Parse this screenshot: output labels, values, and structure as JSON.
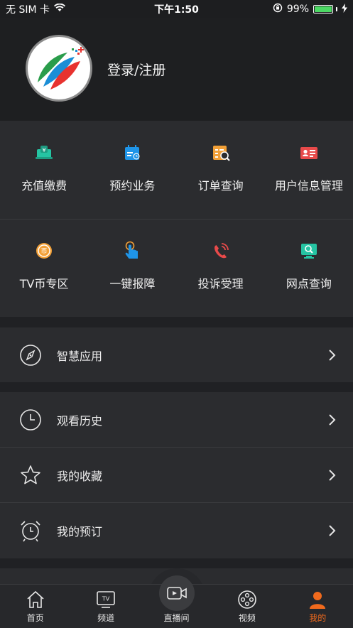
{
  "status": {
    "carrier": "无 SIM 卡",
    "time": "下午1:50",
    "battery": "99%",
    "battery_level": 0.99
  },
  "profile": {
    "login_label": "登录/注册"
  },
  "grid": [
    {
      "label": "充值缴费",
      "icon": "wallet-icon",
      "color": "#25c4a3"
    },
    {
      "label": "预约业务",
      "icon": "calendar-icon",
      "color": "#1f95e8"
    },
    {
      "label": "订单查询",
      "icon": "order-search-icon",
      "color": "#f2a037"
    },
    {
      "label": "用户信息管理",
      "icon": "id-card-icon",
      "color": "#e84a4a"
    },
    {
      "label": "TV币专区",
      "icon": "tv-coin-icon",
      "color": "#f2a037"
    },
    {
      "label": "一键报障",
      "icon": "tap-report-icon",
      "color": "#1f95e8"
    },
    {
      "label": "投诉受理",
      "icon": "phone-complaint-icon",
      "color": "#e84a4a"
    },
    {
      "label": "网点查询",
      "icon": "outlet-search-icon",
      "color": "#25c4a3"
    }
  ],
  "menu": {
    "smart_apps": "智慧应用",
    "history": "观看历史",
    "favorites": "我的收藏",
    "reservations": "我的预订"
  },
  "tabs": [
    {
      "label": "首页",
      "icon": "home-icon"
    },
    {
      "label": "频道",
      "icon": "tv-channel-icon"
    },
    {
      "label": "直播间",
      "icon": "live-camera-icon"
    },
    {
      "label": "视频",
      "icon": "film-reel-icon"
    },
    {
      "label": "我的",
      "icon": "user-icon",
      "active": true
    }
  ],
  "colors": {
    "accent": "#f06a1d",
    "background": "#202124",
    "panel": "#2b2c2f"
  }
}
